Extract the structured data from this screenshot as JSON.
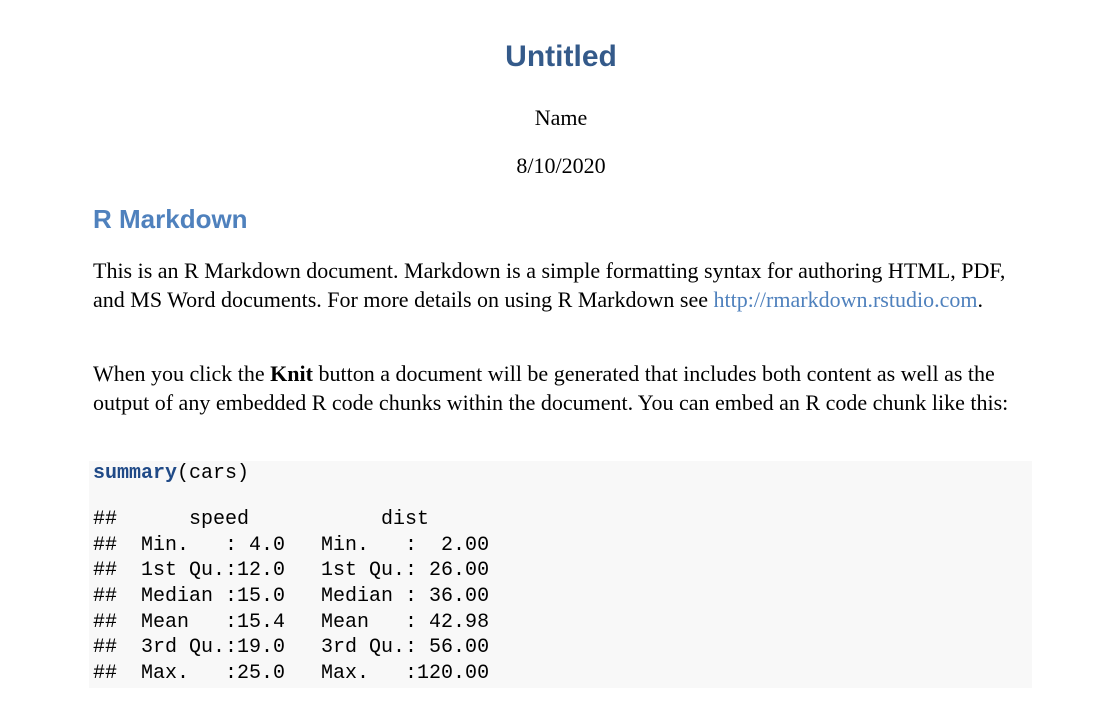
{
  "document": {
    "title": "Untitled",
    "author": "Name",
    "date": "8/10/2020",
    "section_heading": "R Markdown",
    "paragraph1": {
      "text_before_link": "This is an R Markdown document. Markdown is a simple formatting syntax for authoring HTML, PDF, and MS Word documents. For more details on using R Markdown see ",
      "link_text": "http://rmarkdown.rstudio.com",
      "text_after_link": "."
    },
    "paragraph2": {
      "text_before_bold": "When you click the ",
      "bold_text": "Knit",
      "text_after_bold": " button a document will be generated that includes both content as well as the output of any embedded R code chunks within the document. You can embed an R code chunk like this:"
    },
    "code": {
      "function_name": "summary",
      "call_args": "(cars)",
      "output_lines": [
        "##      speed           dist       ",
        "##  Min.   : 4.0   Min.   :  2.00  ",
        "##  1st Qu.:12.0   1st Qu.: 26.00  ",
        "##  Median :15.0   Median : 36.00  ",
        "##  Mean   :15.4   Mean   : 42.98  ",
        "##  3rd Qu.:19.0   3rd Qu.: 56.00  ",
        "##  Max.   :25.0   Max.   :120.00  "
      ]
    },
    "colors": {
      "title": "#345a8a",
      "heading": "#4f81bd",
      "link": "#4f81bd",
      "code_background": "#f8f8f8",
      "code_keyword": "#204a87"
    }
  }
}
